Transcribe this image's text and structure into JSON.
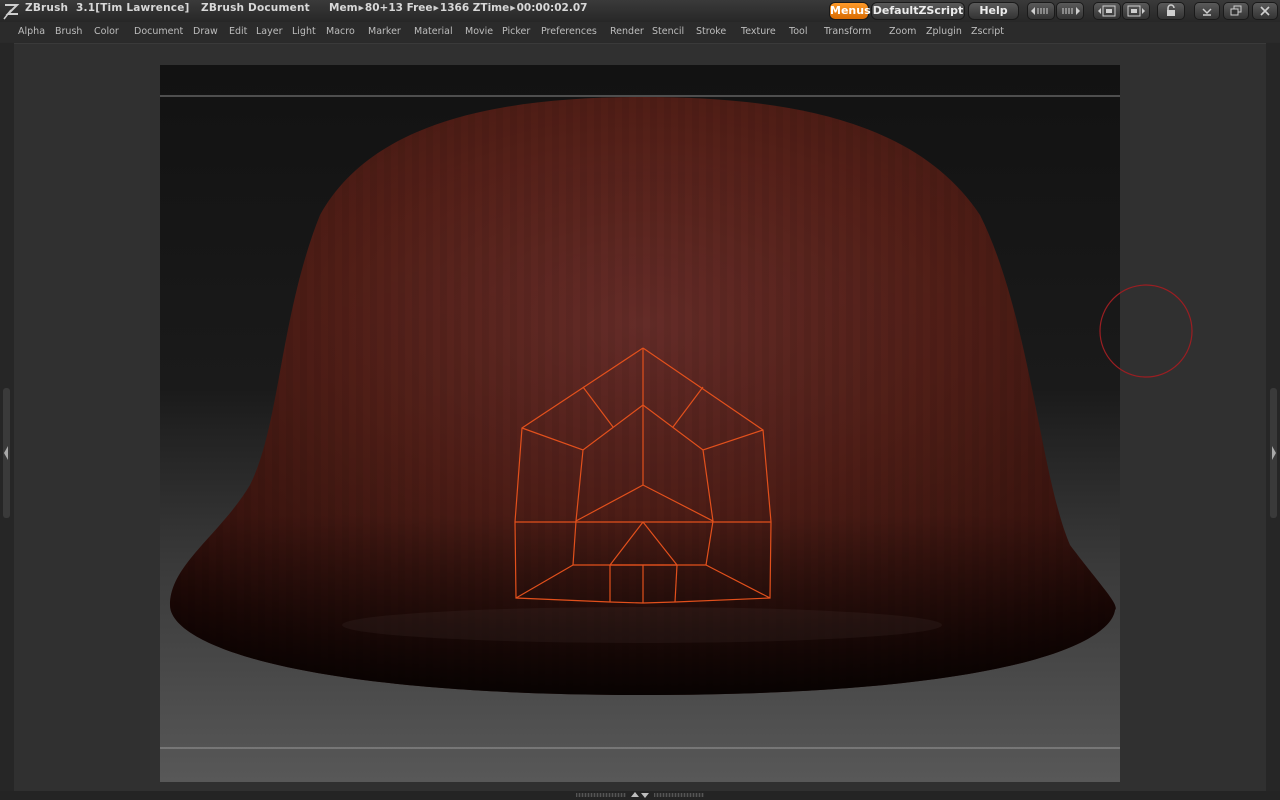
{
  "titlebar": {
    "app_name": "ZBrush",
    "version_user": "3.1[Tim Lawrence]",
    "document": "ZBrush Document",
    "mem_label": "Mem",
    "mem_value": "80+13",
    "free_label": "Free",
    "free_value": "1366",
    "ztime_label": "ZTime",
    "ztime_value": "00:00:02.07"
  },
  "buttons": {
    "menus": "Menus",
    "default_zscript": "DefaultZScript",
    "help": "Help"
  },
  "menu": {
    "items": [
      "Alpha",
      "Brush",
      "Color",
      "Document",
      "Draw",
      "Edit",
      "Layer",
      "Light",
      "Macro",
      "Marker",
      "Material",
      "Movie",
      "Picker",
      "Preferences",
      "Render",
      "Stencil",
      "Stroke",
      "Texture",
      "Tool",
      "Transform",
      "Zoom",
      "Zplugin",
      "Zscript"
    ]
  },
  "colors": {
    "accent": "#f07f10",
    "mesh": "#4b1e18",
    "wire": "#e2501c",
    "brush_cursor": "#9a1e22"
  },
  "icons": {
    "logo": "zbrush-logo-icon",
    "scroll_left": "scroll-left-icon",
    "scroll_right": "scroll-right-icon",
    "float_left": "float-left-icon",
    "float_right": "float-right-icon",
    "lock": "lock-icon",
    "minimize": "minimize-icon",
    "restore": "restore-icon",
    "close": "close-icon"
  }
}
